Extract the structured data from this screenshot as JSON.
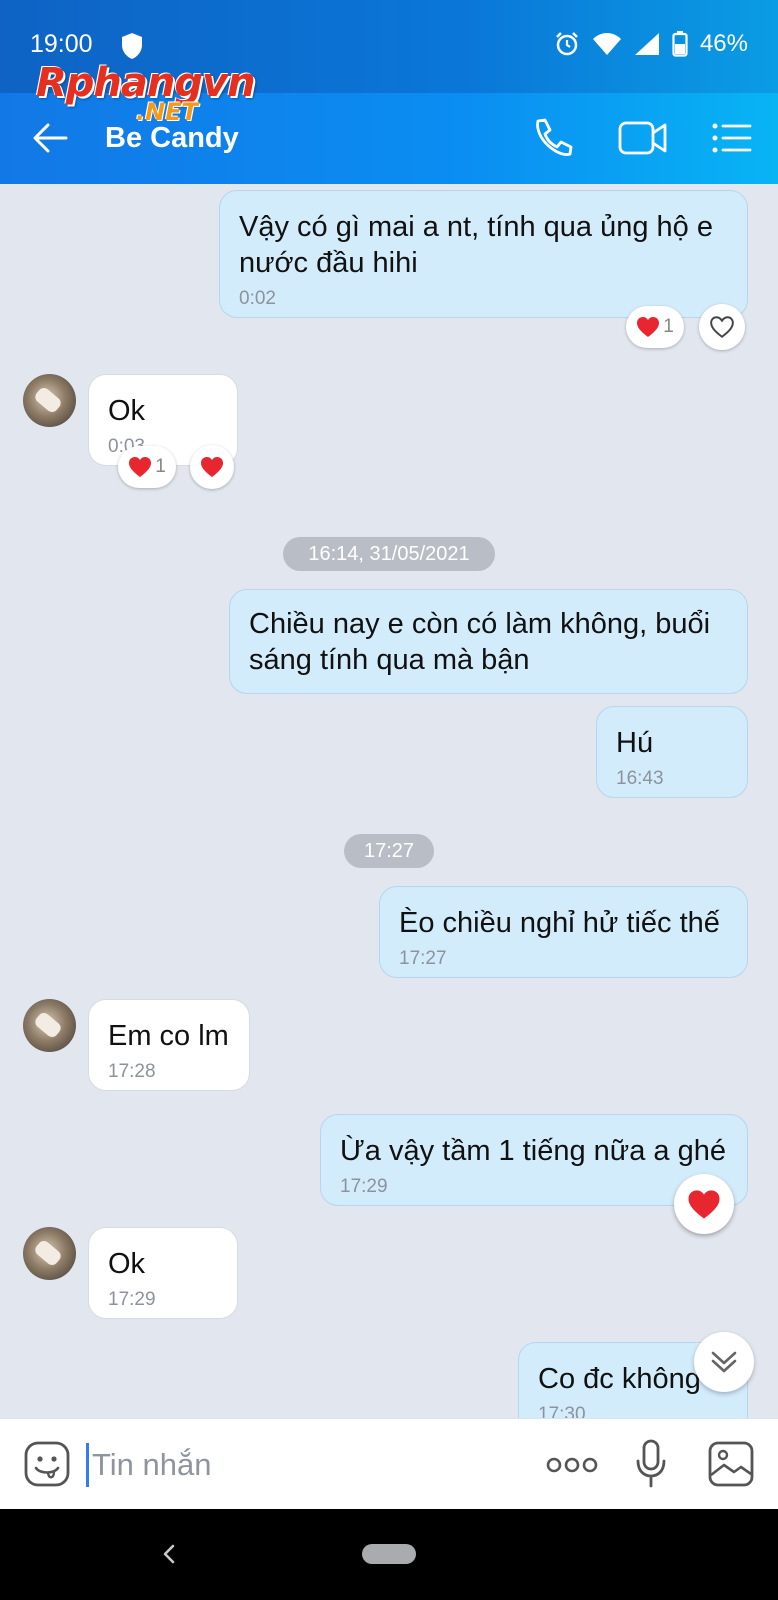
{
  "status_bar": {
    "time": "19:00",
    "battery": "46%"
  },
  "watermark": {
    "main": "Rphangvn",
    "suffix": ".NET"
  },
  "header": {
    "title": "Be Candy"
  },
  "messages": [
    {
      "text": "Vậy có gì mai a nt, tính qua ủng hộ e nước đầu hihi",
      "time": "0:02",
      "reaction_count": "1"
    },
    {
      "text": "Ok",
      "time": "0:03",
      "reaction_count": "1"
    },
    {
      "text": "Chiều nay e còn có làm không, buổi sáng tính qua mà bận"
    },
    {
      "text": "Hú",
      "time": "16:43"
    },
    {
      "text": "Èo chiều nghỉ hử tiếc thế",
      "time": "17:27"
    },
    {
      "text": "Em co lm",
      "time": "17:28"
    },
    {
      "text": "Ừa vậy tầm 1 tiếng nữa a ghé",
      "time": "17:29"
    },
    {
      "text": "Ok",
      "time": "17:29"
    },
    {
      "text": "Co đc không",
      "time": "17:30"
    }
  ],
  "date_separators": [
    "16:14, 31/05/2021",
    "17:27"
  ],
  "input": {
    "placeholder": "Tin nhắn"
  },
  "colors": {
    "header_start": "#1278e6",
    "header_end": "#08b4f4",
    "sent_bubble": "#d3ecfb",
    "received_bubble": "#ffffff",
    "heart": "#e8262f",
    "chat_background": "#e2e6ee"
  },
  "icons": [
    "back-arrow-icon",
    "phone-icon",
    "video-call-icon",
    "menu-list-icon",
    "heart-icon",
    "heart-outline-icon",
    "chevron-double-down-icon",
    "sticker-icon",
    "more-dots-icon",
    "microphone-icon",
    "image-icon"
  ]
}
